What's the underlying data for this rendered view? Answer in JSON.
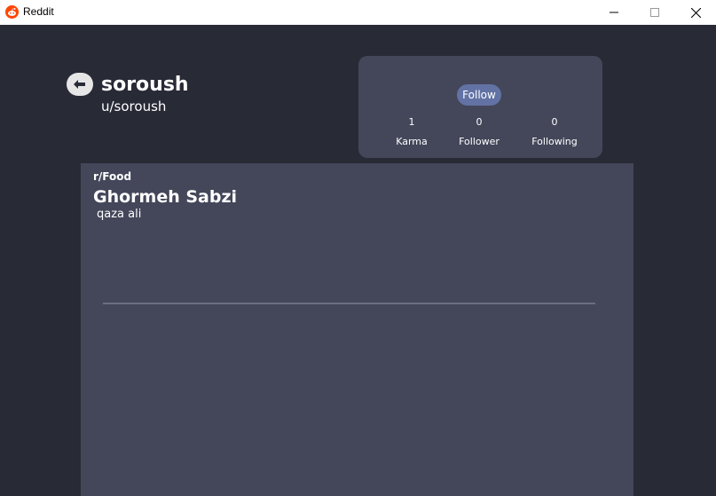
{
  "window": {
    "title": "Reddit",
    "app_icon": "reddit-icon",
    "controls": [
      "minimize-icon",
      "maximize-icon",
      "close-icon"
    ]
  },
  "profile": {
    "back_icon": "arrow-left-icon",
    "username": "soroush",
    "handle": "u/soroush"
  },
  "stats": {
    "follow_label": "Follow",
    "karma_value": "1",
    "karma_label": "Karma",
    "follower_value": "0",
    "follower_label": "Follower",
    "following_value": "0",
    "following_label": "Following"
  },
  "post": {
    "subreddit": "r/Food",
    "title": "Ghormeh Sabzi",
    "body": "qaza ali"
  },
  "colors": {
    "background": "#282a36",
    "panel": "#44475a",
    "accent": "#6272a4",
    "titlebar": "#ffffff"
  }
}
